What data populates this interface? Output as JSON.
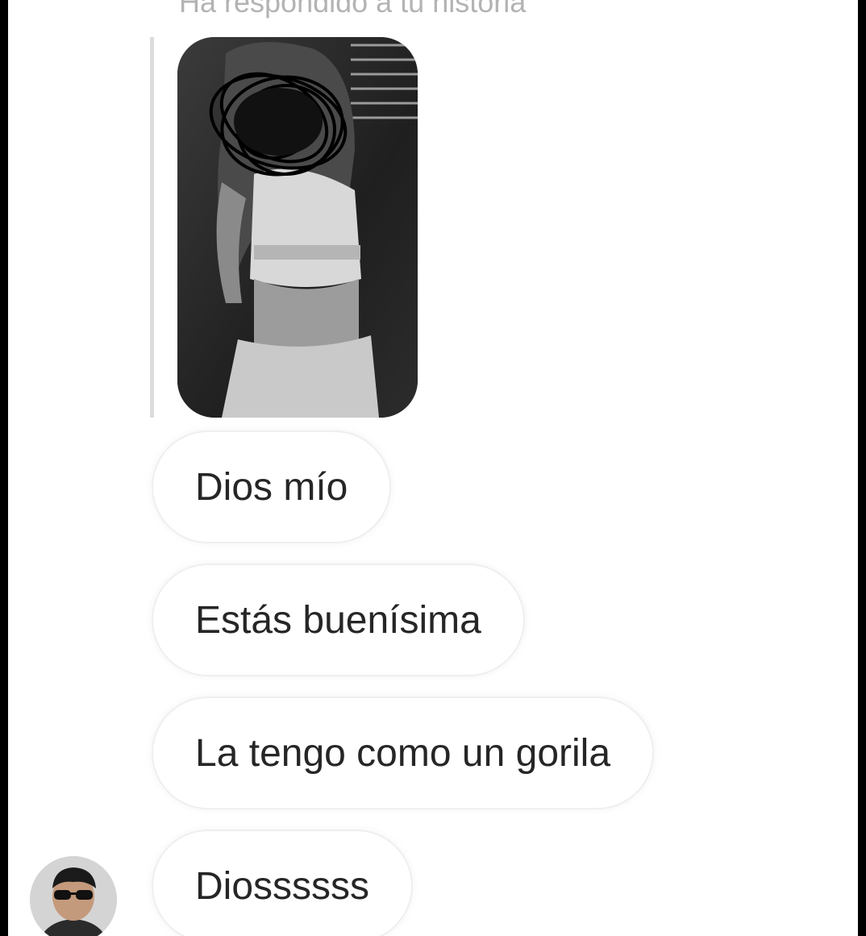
{
  "story_reply": {
    "caption": "Ha respondido a tu historia"
  },
  "messages": [
    {
      "text": "Dios mío"
    },
    {
      "text": "Estás buenísima"
    },
    {
      "text": "La tengo como un gorila"
    },
    {
      "text": "Diossssss"
    }
  ],
  "icons": {
    "story": "story-thumbnail-image",
    "avatar": "user-avatar-image"
  },
  "colors": {
    "bubble_border": "#efefef",
    "text": "#262626",
    "caption": "#b3b3b3"
  }
}
